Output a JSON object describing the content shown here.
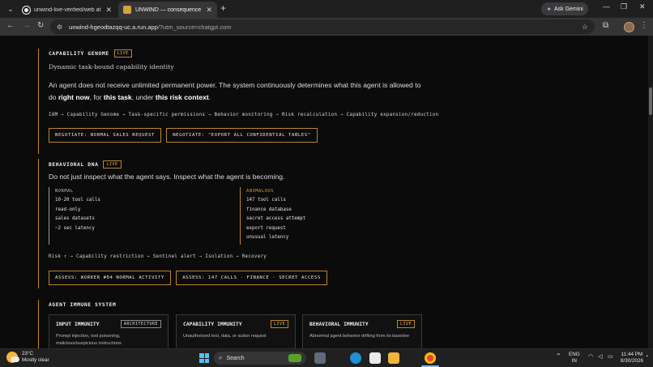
{
  "browser": {
    "tabs": [
      {
        "title": "unwind-live-verified/web at m…",
        "active": false
      },
      {
        "title": "UNWIND — consequence clea…",
        "active": true
      }
    ],
    "ask_gemini": "Ask Gemini",
    "url_host": "unwind-hgeodtazqq-uc.a.run.app",
    "url_query": "/?utm_source=chatgpt.com"
  },
  "genome": {
    "title": "CAPABILITY GENOME",
    "badge": "LIVE",
    "subtitle": "Dynamic task-bound capability identity",
    "para_prefix": "An agent does not receive unlimited permanent power. The system continuously determines what this agent is allowed to do ",
    "para_b1": "right now",
    "para_mid1": ", for ",
    "para_b2": "this task",
    "para_mid2": ", under ",
    "para_b3": "this risk context",
    "para_end": ".",
    "flow": "IAM → Capability Genome → Task-specific permissions → Behavior monitoring → Risk recalculation → Capability expansion/reduction",
    "btn1": "NEGOTIATE: NORMAL SALES REQUEST",
    "btn2": "NEGOTIATE: \"EXPORT ALL CONFIDENTIAL TABLES\""
  },
  "dna": {
    "title": "BEHAVIORAL DNA",
    "badge": "LIVE",
    "para": "Do not just inspect what the agent says. Inspect what the agent is becoming.",
    "normal_header": "NORMAL",
    "normal_items": [
      "10-20 tool calls",
      "read-only",
      "sales datasets",
      "~2 sec latency"
    ],
    "anomalous_header": "ANOMALOUS",
    "anomalous_items": [
      "147 tool calls",
      "finance database",
      "secret access attempt",
      "export request",
      "unusual latency"
    ],
    "flow": "Risk ↑ → Capability restriction → Sentinel alert → Isolation → Recovery",
    "btn1": "ASSESS: WORKER #04 NORMAL ACTIVITY",
    "btn2": "ASSESS: 147 CALLS · FINANCE · SECRET ACCESS"
  },
  "immune": {
    "title": "AGENT IMMUNE SYSTEM",
    "cards": [
      {
        "title": "INPUT IMMUNITY",
        "badge": "ARCHITECTURE",
        "desc1": "Prompt injection, tool poisoning,",
        "desc2": "malicious/suspicious instructions"
      },
      {
        "title": "CAPABILITY IMMUNITY",
        "badge": "LIVE",
        "desc1": "Unauthorized tool, data, or action request",
        "desc2": ""
      },
      {
        "title": "BEHAVIORAL IMMUNITY",
        "badge": "LIVE",
        "desc1": "Abnormal agent behavior drifting from its baseline",
        "desc2": ""
      }
    ]
  },
  "taskbar": {
    "temp": "23°C",
    "weather": "Mostly clear",
    "search": "Search",
    "lang1": "ENG",
    "lang2": "IN",
    "time": "11:44 PM",
    "date": "8/30/2026"
  }
}
